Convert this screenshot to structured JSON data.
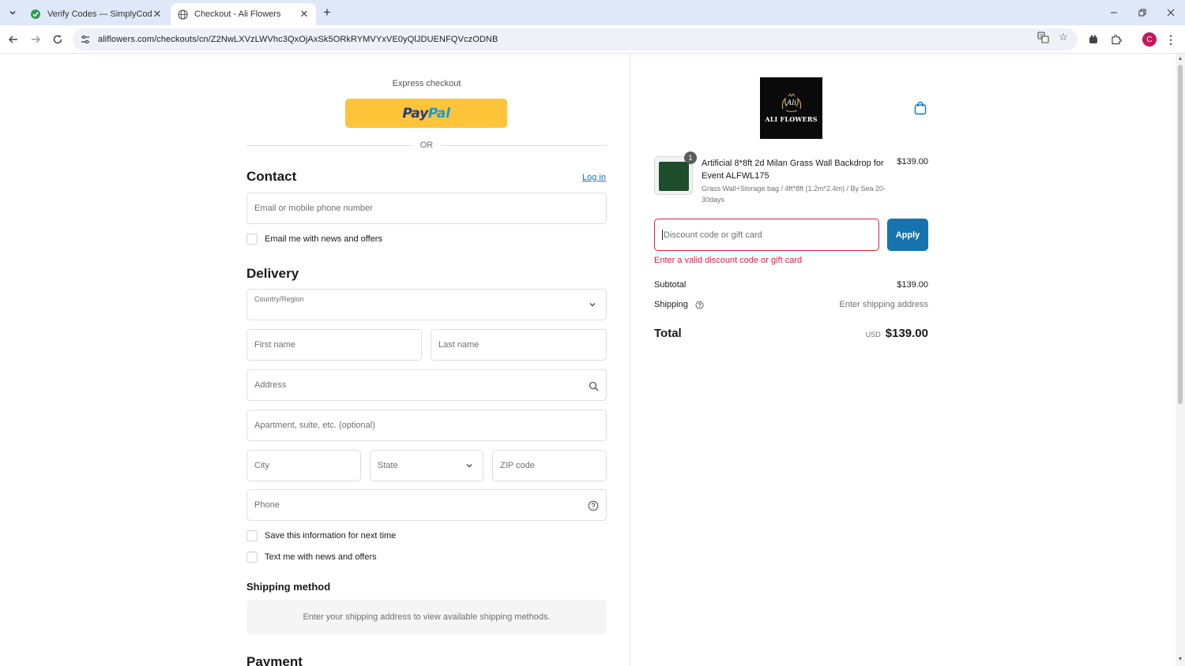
{
  "browser": {
    "tabs": [
      {
        "title": "Verify Codes — SimplyCodes",
        "active": false,
        "favicon": "simplycodes-icon"
      },
      {
        "title": "Checkout - Ali Flowers",
        "active": true,
        "favicon": "globe-icon"
      }
    ],
    "url": "aliflowers.com/checkouts/cn/Z2NwLXVzLWVhc3QxOjAxSk5ORkRYMVYxVE0yQlJDUENFQVczODNB",
    "profile_initial": "C"
  },
  "checkout": {
    "express_label": "Express checkout",
    "paypal_pay": "Pay",
    "paypal_pal": "Pal",
    "or_label": "OR",
    "contact": {
      "heading": "Contact",
      "login_link": "Log in",
      "email_placeholder": "Email or mobile phone number",
      "newsletter_label": "Email me with news and offers"
    },
    "delivery": {
      "heading": "Delivery",
      "country_label": "Country/Region",
      "first_name_placeholder": "First name",
      "last_name_placeholder": "Last name",
      "address_placeholder": "Address",
      "apartment_placeholder": "Apartment, suite, etc. (optional)",
      "city_placeholder": "City",
      "state_placeholder": "State",
      "zip_placeholder": "ZIP code",
      "phone_placeholder": "Phone",
      "save_info_label": "Save this information for next time",
      "text_offers_label": "Text me with news and offers"
    },
    "shipping_method": {
      "heading": "Shipping method",
      "notice": "Enter your shipping address to view available shipping methods."
    },
    "payment": {
      "heading": "Payment"
    }
  },
  "summary": {
    "logo_script": "Ali",
    "logo_text": "ALI FLOWERS",
    "item": {
      "quantity": "1",
      "name": "Artificial 8*8ft 2d Milan Grass Wall Backdrop for Event ALFWL175",
      "variant": "Grass Wall+Storage bag / 4ft*8ft (1.2m*2.4m) / By Sea 20-30days",
      "price": "$139.00"
    },
    "discount_placeholder": "Discount code or gift card",
    "apply_label": "Apply",
    "discount_error": "Enter a valid discount code or gift card",
    "subtotal_label": "Subtotal",
    "subtotal_value": "$139.00",
    "shipping_label": "Shipping",
    "shipping_value": "Enter shipping address",
    "total_label": "Total",
    "currency": "USD",
    "total_value": "$139.00"
  },
  "colors": {
    "accent": "#1773b0",
    "error": "#dd1d4a",
    "paypal_yellow": "#ffc439"
  }
}
